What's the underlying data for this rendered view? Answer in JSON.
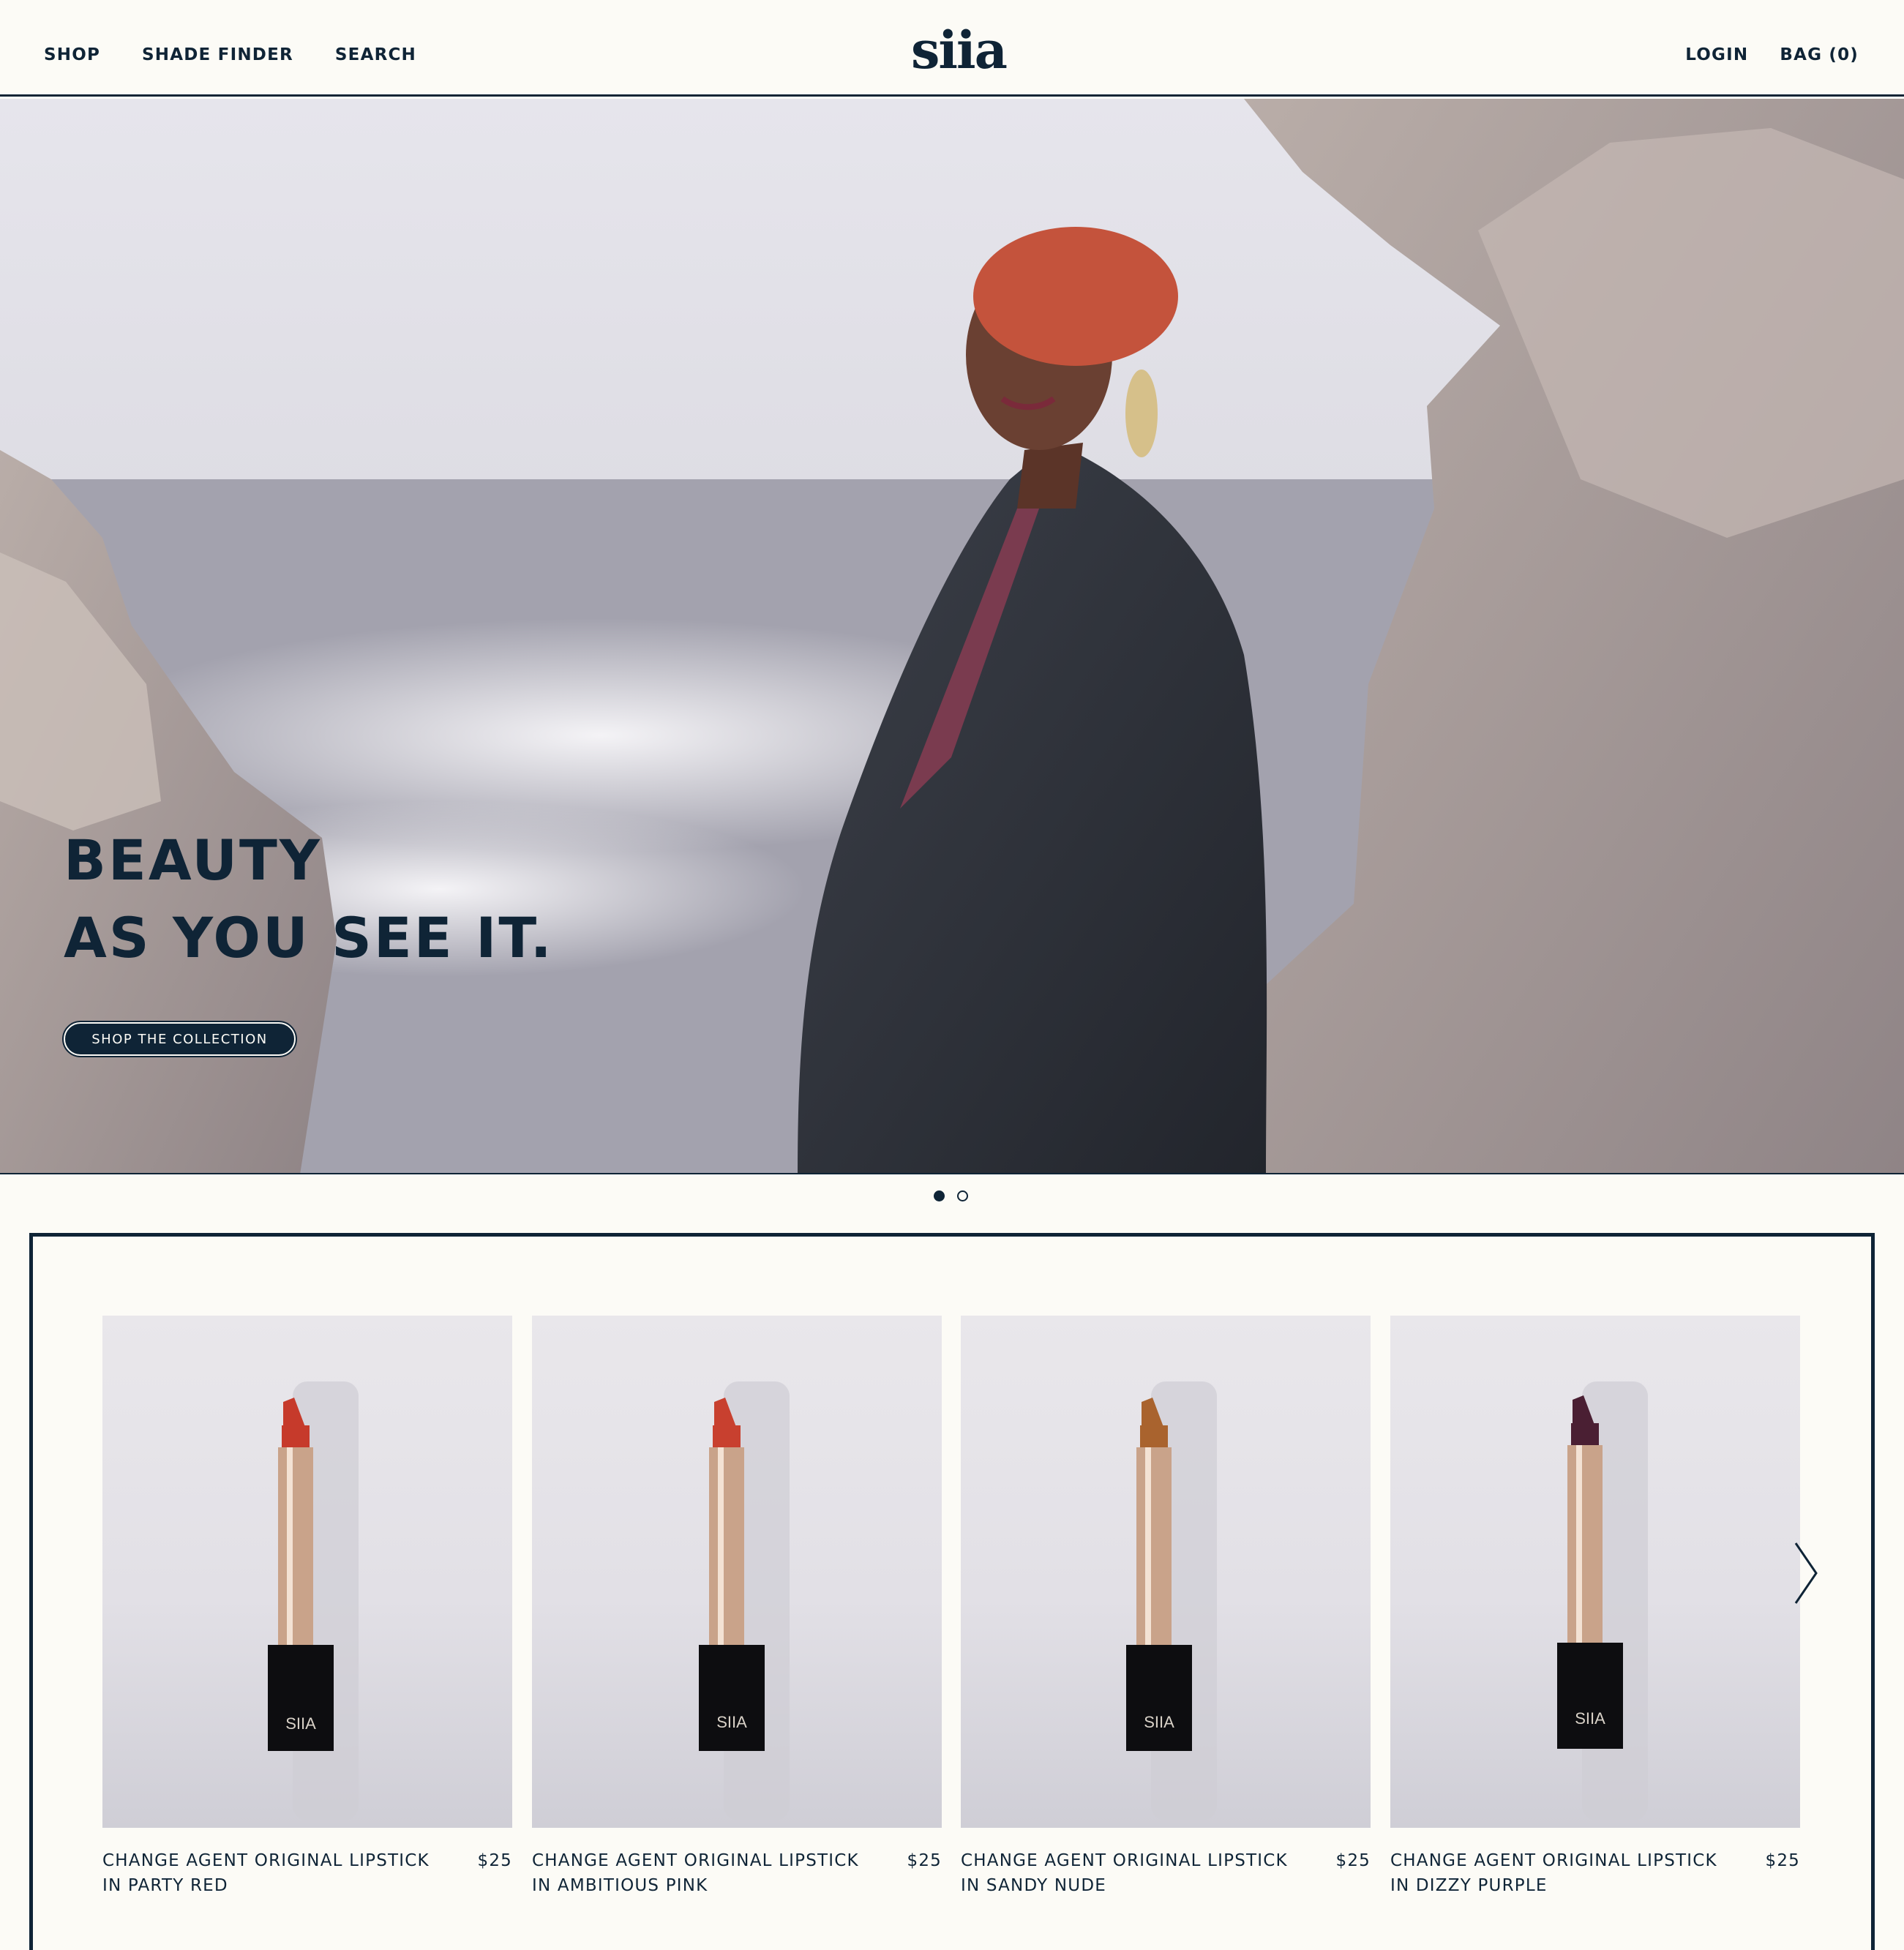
{
  "header": {
    "nav_left": [
      "SHOP",
      "SHADE FINDER",
      "SEARCH"
    ],
    "logo": "siia",
    "login": "LOGIN",
    "bag": "BAG (0)"
  },
  "hero": {
    "title_line1": "BEAUTY",
    "title_line2": "AS YOU SEE IT.",
    "cta": "SHOP THE COLLECTION",
    "slide_count": 2,
    "active_slide": 1
  },
  "products": [
    {
      "name_line1": "CHANGE AGENT ORIGINAL LIPSTICK",
      "name_line2": "IN PARTY RED",
      "price": "$25",
      "bullet_color": "#c63a2b",
      "brand": "SIIA"
    },
    {
      "name_line1": "CHANGE AGENT ORIGINAL LIPSTICK",
      "name_line2": "IN AMBITIOUS PINK",
      "price": "$25",
      "bullet_color": "#c8402f",
      "brand": "SIIA"
    },
    {
      "name_line1": "CHANGE AGENT ORIGINAL LIPSTICK",
      "name_line2": "IN SANDY NUDE",
      "price": "$25",
      "bullet_color": "#a9632e",
      "brand": "SIIA"
    },
    {
      "name_line1": "CHANGE AGENT ORIGINAL LIPSTICK",
      "name_line2": "IN DIZZY PURPLE",
      "price": "$25",
      "bullet_color": "#4a1f33",
      "brand": "SIIA"
    }
  ],
  "icons": {
    "next": "chevron-right-icon"
  },
  "colors": {
    "navy": "#0f2436",
    "cream": "#fcfbf6"
  }
}
